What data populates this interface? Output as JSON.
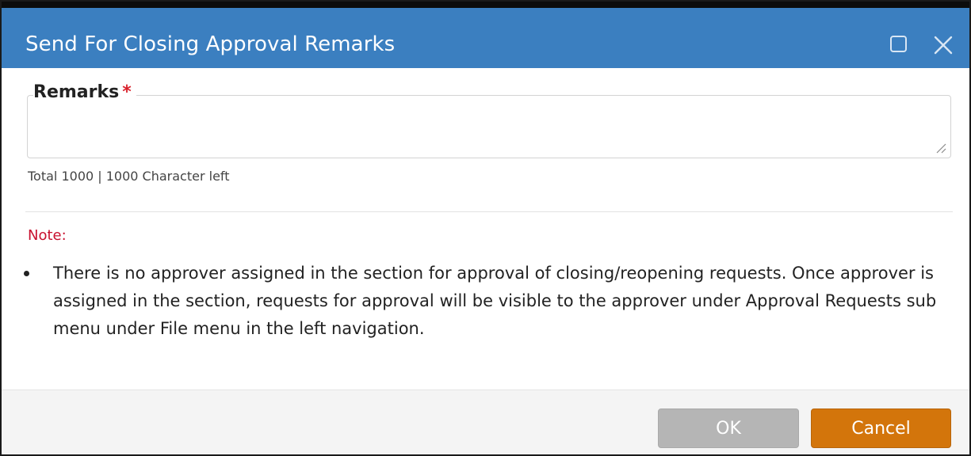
{
  "dialog": {
    "title": "Send For Closing Approval Remarks",
    "title_bar_color": "#3b7fc0",
    "controls": {
      "maximize_icon": "maximize-icon",
      "close_icon": "close-icon"
    }
  },
  "remarks": {
    "label": "Remarks",
    "required_marker": "*",
    "value": "",
    "char_count_text": "Total 1000 | 1000 Character left"
  },
  "note": {
    "label": "Note:",
    "items": [
      "There is no approver assigned in the section for approval of closing/reopening requests. Once approver is assigned in the section, requests for approval will be visible to the approver under Approval Requests sub menu under File menu in the left navigation."
    ]
  },
  "footer": {
    "ok_label": "OK",
    "cancel_label": "Cancel",
    "ok_color": "#b5b5b5",
    "cancel_color": "#d3750b"
  }
}
